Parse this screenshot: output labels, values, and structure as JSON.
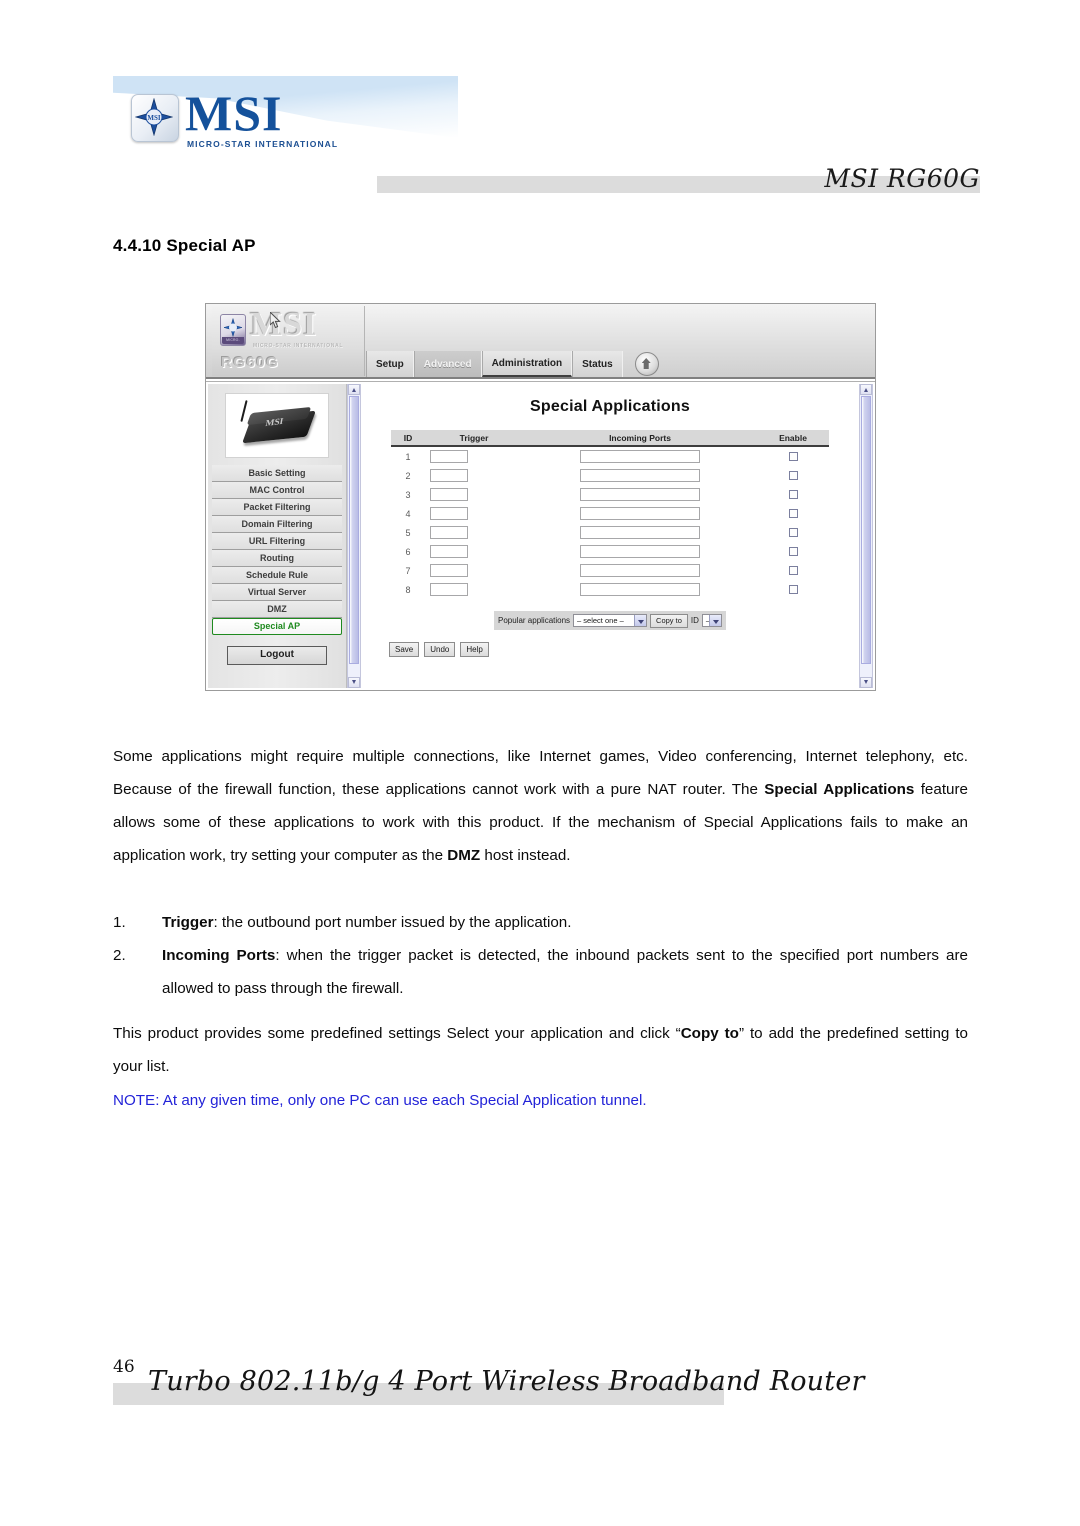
{
  "document": {
    "header": {
      "logo_text": "MSI",
      "logo_subtitle": "MICRO-STAR INTERNATIONAL",
      "title": "MSI RG60G"
    },
    "section_heading": "4.4.10 Special AP",
    "paragraph_1": {
      "part_1": "Some applications might require multiple connections, like Internet games, Video conferencing, Internet telephony, etc. Because of the firewall function, these applications cannot work with a pure NAT router. The ",
      "bold_1": "Special Applications",
      "part_2": " feature allows some of these applications to work with this product. If the mechanism of Special Applications fails to make an application work, try setting your computer as the ",
      "bold_2": "DMZ",
      "part_3": " host instead."
    },
    "list": [
      {
        "number": "1.",
        "bold": "Trigger",
        "text": ": the outbound port number issued by the application."
      },
      {
        "number": "2.",
        "bold": "Incoming Ports",
        "text": ": when the trigger packet is detected, the inbound packets sent to the specified port numbers are allowed to pass through the firewall."
      }
    ],
    "paragraph_3": {
      "part_1": "This product provides some predefined settings Select your application and click “",
      "bold_1": "Copy to",
      "part_2": "” to add the predefined setting to your list."
    },
    "note": "NOTE: At any given time, only one PC can use each Special Application tunnel.",
    "footer": {
      "page_number": "46",
      "title": "Turbo 802.11b/g 4 Port Wireless Broadband Router"
    }
  },
  "router_ui": {
    "brand": "MSI",
    "brand_subtitle": "MICRO-STAR INTERNATIONAL",
    "emblem_label": "MICRO-STAR",
    "model": "RG60G",
    "tabs": [
      {
        "label": "Setup",
        "active": false
      },
      {
        "label": "Advanced",
        "active": true
      },
      {
        "label": "Administration",
        "active": false
      },
      {
        "label": "Status",
        "active": false
      }
    ],
    "home_icon": "home-icon",
    "device_label": "MSI",
    "menu": [
      {
        "label": "Basic Setting",
        "selected": false
      },
      {
        "label": "MAC Control",
        "selected": false
      },
      {
        "label": "Packet Filtering",
        "selected": false
      },
      {
        "label": "Domain Filtering",
        "selected": false
      },
      {
        "label": "URL Filtering",
        "selected": false
      },
      {
        "label": "Routing",
        "selected": false
      },
      {
        "label": "Schedule Rule",
        "selected": false
      },
      {
        "label": "Virtual Server",
        "selected": false
      },
      {
        "label": "DMZ",
        "selected": false
      },
      {
        "label": "Special AP",
        "selected": true
      }
    ],
    "logout_label": "Logout",
    "page_title": "Special Applications",
    "table": {
      "headers": [
        "ID",
        "Trigger",
        "Incoming Ports",
        "Enable"
      ],
      "rows": [
        {
          "id": "1",
          "trigger": "",
          "incoming_ports": "",
          "enable": false
        },
        {
          "id": "2",
          "trigger": "",
          "incoming_ports": "",
          "enable": false
        },
        {
          "id": "3",
          "trigger": "",
          "incoming_ports": "",
          "enable": false
        },
        {
          "id": "4",
          "trigger": "",
          "incoming_ports": "",
          "enable": false
        },
        {
          "id": "5",
          "trigger": "",
          "incoming_ports": "",
          "enable": false
        },
        {
          "id": "6",
          "trigger": "",
          "incoming_ports": "",
          "enable": false
        },
        {
          "id": "7",
          "trigger": "",
          "incoming_ports": "",
          "enable": false
        },
        {
          "id": "8",
          "trigger": "",
          "incoming_ports": "",
          "enable": false
        }
      ]
    },
    "popular": {
      "label": "Popular applications",
      "select_value": "– select one –",
      "copy_button": "Copy to",
      "id_label": "ID",
      "id_value": "–"
    },
    "buttons": {
      "save": "Save",
      "undo": "Undo",
      "help": "Help"
    },
    "selected_accent": "#1f8a1f",
    "note_color": "#2323d8"
  }
}
